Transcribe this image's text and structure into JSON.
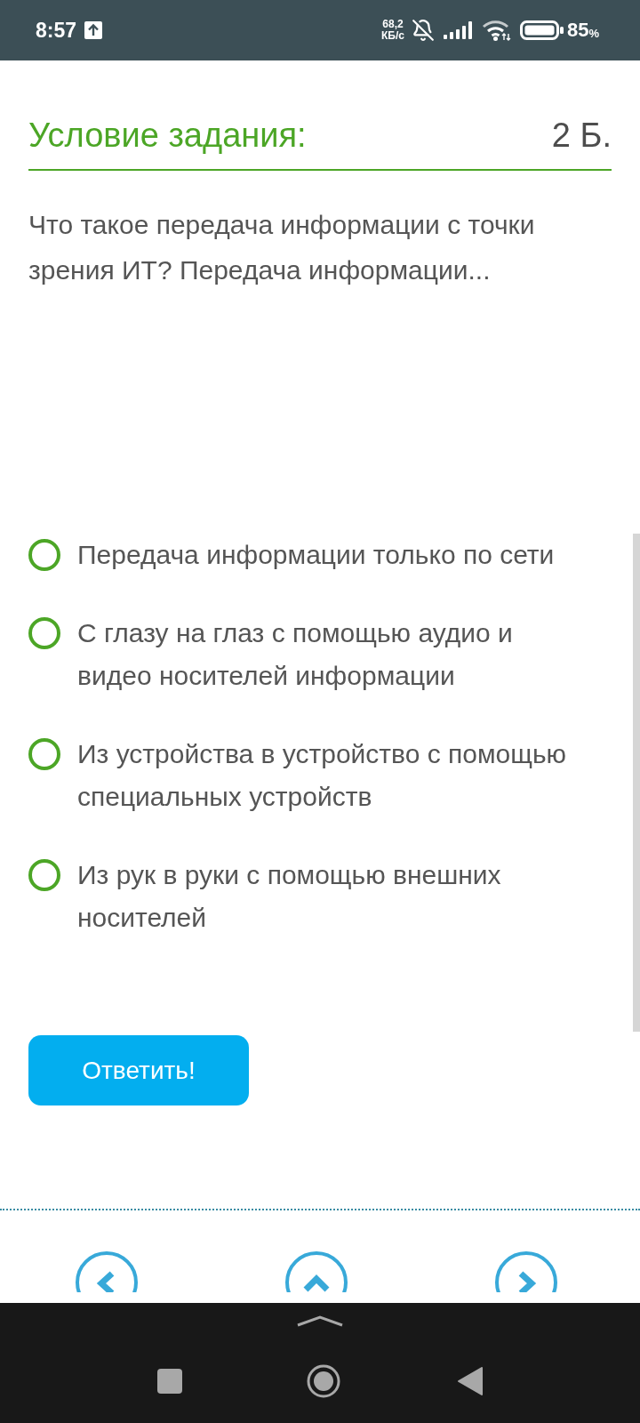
{
  "status_bar": {
    "time": "8:57",
    "net_speed_value": "68,2",
    "net_speed_unit": "КБ/с",
    "battery_percent": "85",
    "battery_unit": "%"
  },
  "task": {
    "title": "Условие задания:",
    "points": "2 Б.",
    "question": "Что такое передача информации с точки зрения ИТ? Передача информации..."
  },
  "options": [
    {
      "label": "Передача информации только по сети",
      "selected": false
    },
    {
      "label": "С глазу на глаз с помощью аудио и видео носителей информации",
      "selected": false
    },
    {
      "label": "Из устройства в устройство с помощью специальных устройств",
      "selected": false
    },
    {
      "label": "Из рук в руки с помощью внешних носителей",
      "selected": false
    }
  ],
  "submit_button": {
    "label": "Ответить!"
  }
}
